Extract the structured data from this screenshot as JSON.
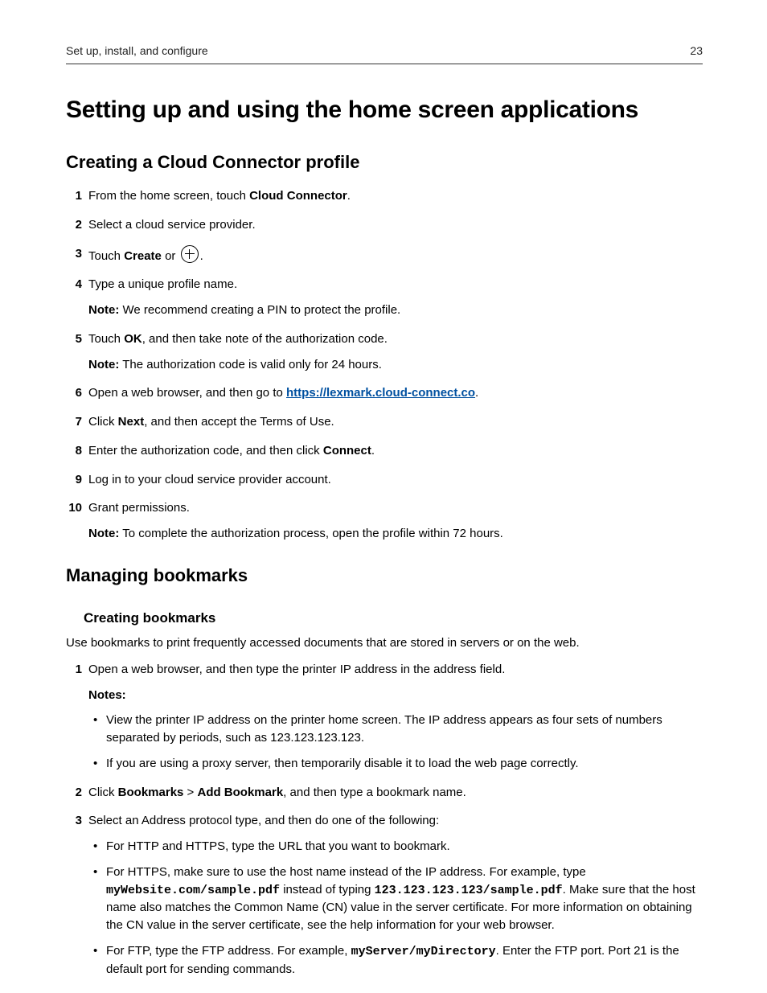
{
  "header": {
    "section": "Set up, install, and configure",
    "page_number": "23"
  },
  "title": "Setting up and using the home screen applications",
  "section1": {
    "heading": "Creating a Cloud Connector profile",
    "steps": {
      "s1_pre": "From the home screen, touch ",
      "s1_bold": "Cloud Connector",
      "s1_post": ".",
      "s2": "Select a cloud service provider.",
      "s3_pre": "Touch ",
      "s3_bold": "Create",
      "s3_mid": " or ",
      "s3_post": ".",
      "s4": "Type a unique profile name.",
      "s4_note_label": "Note:",
      "s4_note": " We recommend creating a PIN to protect the profile.",
      "s5_pre": "Touch ",
      "s5_bold": "OK",
      "s5_post": ", and then take note of the authorization code.",
      "s5_note_label": "Note:",
      "s5_note": " The authorization code is valid only for 24 hours.",
      "s6_pre": "Open a web browser, and then go to ",
      "s6_link": "https://lexmark.cloud-connect.co",
      "s6_post": ".",
      "s7_pre": "Click ",
      "s7_bold": "Next",
      "s7_post": ", and then accept the Terms of Use.",
      "s8_pre": "Enter the authorization code, and then click ",
      "s8_bold": "Connect",
      "s8_post": ".",
      "s9": "Log in to your cloud service provider account.",
      "s10": "Grant permissions.",
      "s10_note_label": "Note:",
      "s10_note": " To complete the authorization process, open the profile within 72 hours."
    }
  },
  "section2": {
    "heading": "Managing bookmarks",
    "sub": {
      "heading": "Creating bookmarks",
      "intro": "Use bookmarks to print frequently accessed documents that are stored in servers or on the web.",
      "s1": "Open a web browser, and then type the printer IP address in the address field.",
      "s1_notes_label": "Notes:",
      "s1_b1": "View the printer IP address on the printer home screen. The IP address appears as four sets of numbers separated by periods, such as 123.123.123.123.",
      "s1_b2": "If you are using a proxy server, then temporarily disable it to load the web page correctly.",
      "s2_pre": "Click ",
      "s2_bold1": "Bookmarks",
      "s2_mid": " > ",
      "s2_bold2": "Add Bookmark",
      "s2_post": ", and then type a bookmark name.",
      "s3": "Select an Address protocol type, and then do one of the following:",
      "s3_b1": "For HTTP and HTTPS, type the URL that you want to bookmark.",
      "s3_b2_pre": "For HTTPS, make sure to use the host name instead of the IP address. For example, type ",
      "s3_b2_mono1": "myWebsite.com/sample.pdf",
      "s3_b2_mid": " instead of typing ",
      "s3_b2_mono2": "123.123.123.123/sample.pdf",
      "s3_b2_post": ". Make sure that the host name also matches the Common Name (CN) value in the server certificate. For more information on obtaining the CN value in the server certificate, see the help information for your web browser.",
      "s3_b3_pre": "For FTP, type the FTP address. For example, ",
      "s3_b3_mono": "myServer/myDirectory",
      "s3_b3_post": ". Enter the FTP port. Port 21 is the default port for sending commands."
    }
  }
}
